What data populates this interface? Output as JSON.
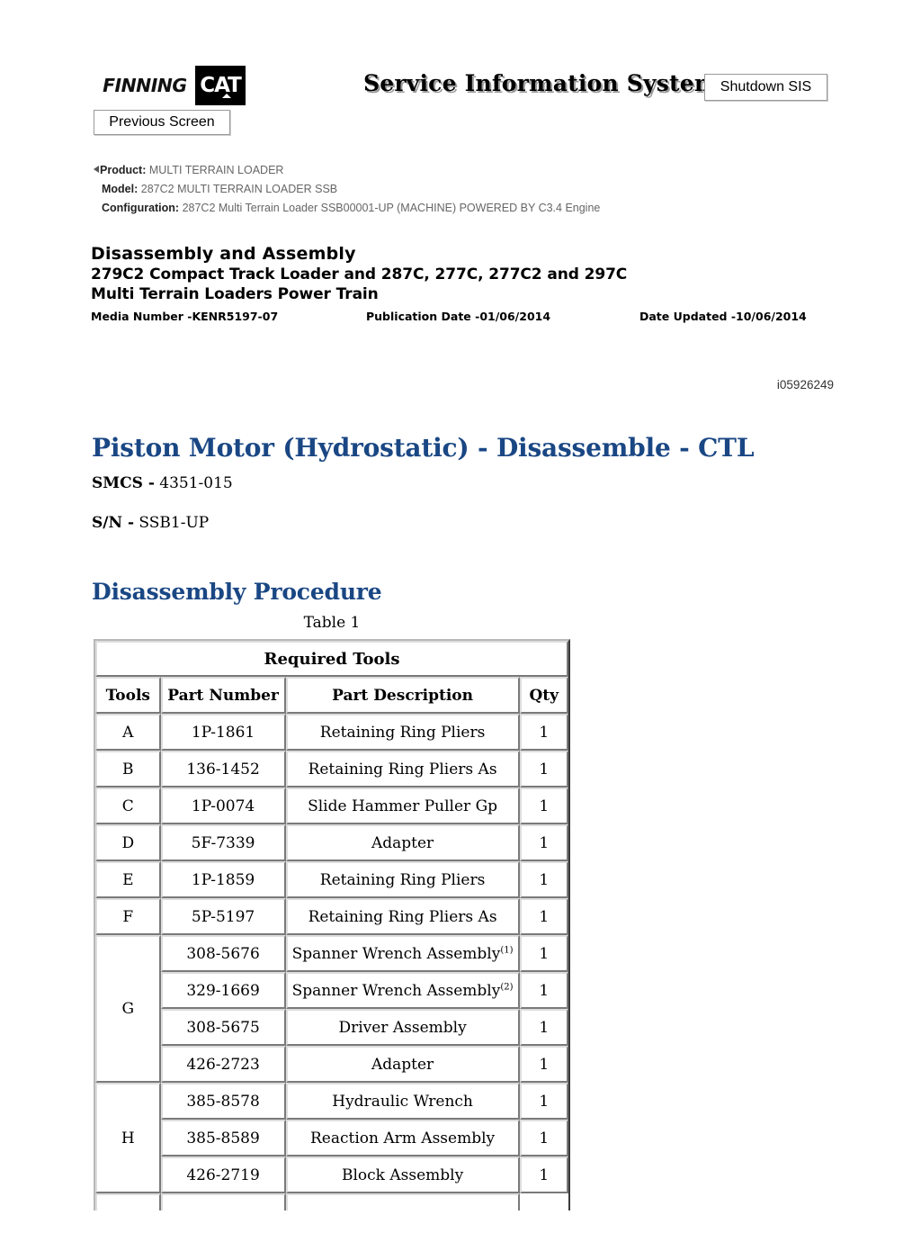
{
  "header": {
    "logo_finning": "FINNING",
    "logo_cat": "CAT",
    "sis_title": "Service Information System",
    "shutdown_label": "Shutdown SIS",
    "previous_screen_label": "Previous Screen"
  },
  "breadcrumb": {
    "product_label": "Product:",
    "product_value": "MULTI TERRAIN LOADER",
    "model_label": "Model:",
    "model_value": "287C2 MULTI TERRAIN LOADER SSB",
    "configuration_label": "Configuration:",
    "configuration_value": "287C2 Multi Terrain Loader SSB00001-UP (MACHINE) POWERED BY C3.4 Engine"
  },
  "document": {
    "heading": "Disassembly and Assembly",
    "subheading_line1": "279C2 Compact Track Loader and 287C, 277C, 277C2 and 297C",
    "subheading_line2": "Multi Terrain Loaders Power Train",
    "media_number": "Media Number -KENR5197-07",
    "publication_date": "Publication Date -01/06/2014",
    "date_updated": "Date Updated -10/06/2014",
    "doc_id": "i05926249"
  },
  "article": {
    "title": "Piston Motor (Hydrostatic) - Disassemble - CTL",
    "smcs_label": "SMCS -",
    "smcs_value": "4351-015",
    "sn_label": "S/N -",
    "sn_value": "SSB1-UP",
    "section_title": "Disassembly Procedure"
  },
  "table": {
    "caption": "Table 1",
    "title": "Required Tools",
    "columns": [
      "Tools",
      "Part Number",
      "Part Description",
      "Qty"
    ],
    "rows": [
      {
        "tool": "A",
        "part_number": "1P-1861",
        "description": "Retaining Ring Pliers",
        "sup": "",
        "qty": "1",
        "rowspan": 1
      },
      {
        "tool": "B",
        "part_number": "136-1452",
        "description": "Retaining Ring Pliers As",
        "sup": "",
        "qty": "1",
        "rowspan": 1
      },
      {
        "tool": "C",
        "part_number": "1P-0074",
        "description": "Slide Hammer Puller Gp",
        "sup": "",
        "qty": "1",
        "rowspan": 1
      },
      {
        "tool": "D",
        "part_number": "5F-7339",
        "description": "Adapter",
        "sup": "",
        "qty": "1",
        "rowspan": 1
      },
      {
        "tool": "E",
        "part_number": "1P-1859",
        "description": "Retaining Ring Pliers",
        "sup": "",
        "qty": "1",
        "rowspan": 1
      },
      {
        "tool": "F",
        "part_number": "5P-5197",
        "description": "Retaining Ring Pliers As",
        "sup": "",
        "qty": "1",
        "rowspan": 1
      },
      {
        "tool": "G",
        "part_number": "308-5676",
        "description": "Spanner Wrench Assembly",
        "sup": "(1)",
        "qty": "1",
        "rowspan": 4
      },
      {
        "tool": "",
        "part_number": "329-1669",
        "description": "Spanner Wrench Assembly",
        "sup": "(2)",
        "qty": "1",
        "rowspan": 0
      },
      {
        "tool": "",
        "part_number": "308-5675",
        "description": "Driver Assembly",
        "sup": "",
        "qty": "1",
        "rowspan": 0
      },
      {
        "tool": "",
        "part_number": "426-2723",
        "description": "Adapter",
        "sup": "",
        "qty": "1",
        "rowspan": 0
      },
      {
        "tool": "H",
        "part_number": "385-8578",
        "description": "Hydraulic Wrench",
        "sup": "",
        "qty": "1",
        "rowspan": 3
      },
      {
        "tool": "",
        "part_number": "385-8589",
        "description": "Reaction Arm Assembly",
        "sup": "",
        "qty": "1",
        "rowspan": 0
      },
      {
        "tool": "",
        "part_number": "426-2719",
        "description": "Block Assembly",
        "sup": "",
        "qty": "1",
        "rowspan": 0
      },
      {
        "tool": "",
        "part_number": "",
        "description": "",
        "sup": "",
        "qty": "",
        "rowspan": 0
      }
    ]
  },
  "colors": {
    "heading_blue": "#1a4784",
    "text_black": "#000000",
    "crumb_gray": "#666666"
  }
}
